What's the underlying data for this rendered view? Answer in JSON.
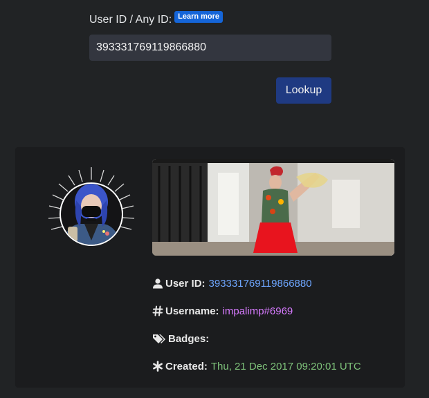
{
  "form": {
    "label": "User ID / Any ID:",
    "learn_more": "Learn more",
    "input_value": "393331769119866880",
    "lookup_label": "Lookup"
  },
  "profile": {
    "user_id_label": "User ID",
    "user_id_value": "393331769119866880",
    "username_label": "Username",
    "username_value": "impalimp#6969",
    "badges_label": "Badges",
    "created_label": "Created",
    "created_value": "Thu, 21 Dec 2017 09:20:01 UTC"
  },
  "icons": {
    "user": "user-icon",
    "username": "hash-icon",
    "badges": "tags-icon",
    "created": "asterisk-icon"
  },
  "colors": {
    "accent_button": "#1f3a82",
    "learn_more_badge": "#1565d8",
    "user_id_value": "#6ea6ff",
    "username_value": "#d77bff",
    "created_value": "#7ec27a"
  }
}
